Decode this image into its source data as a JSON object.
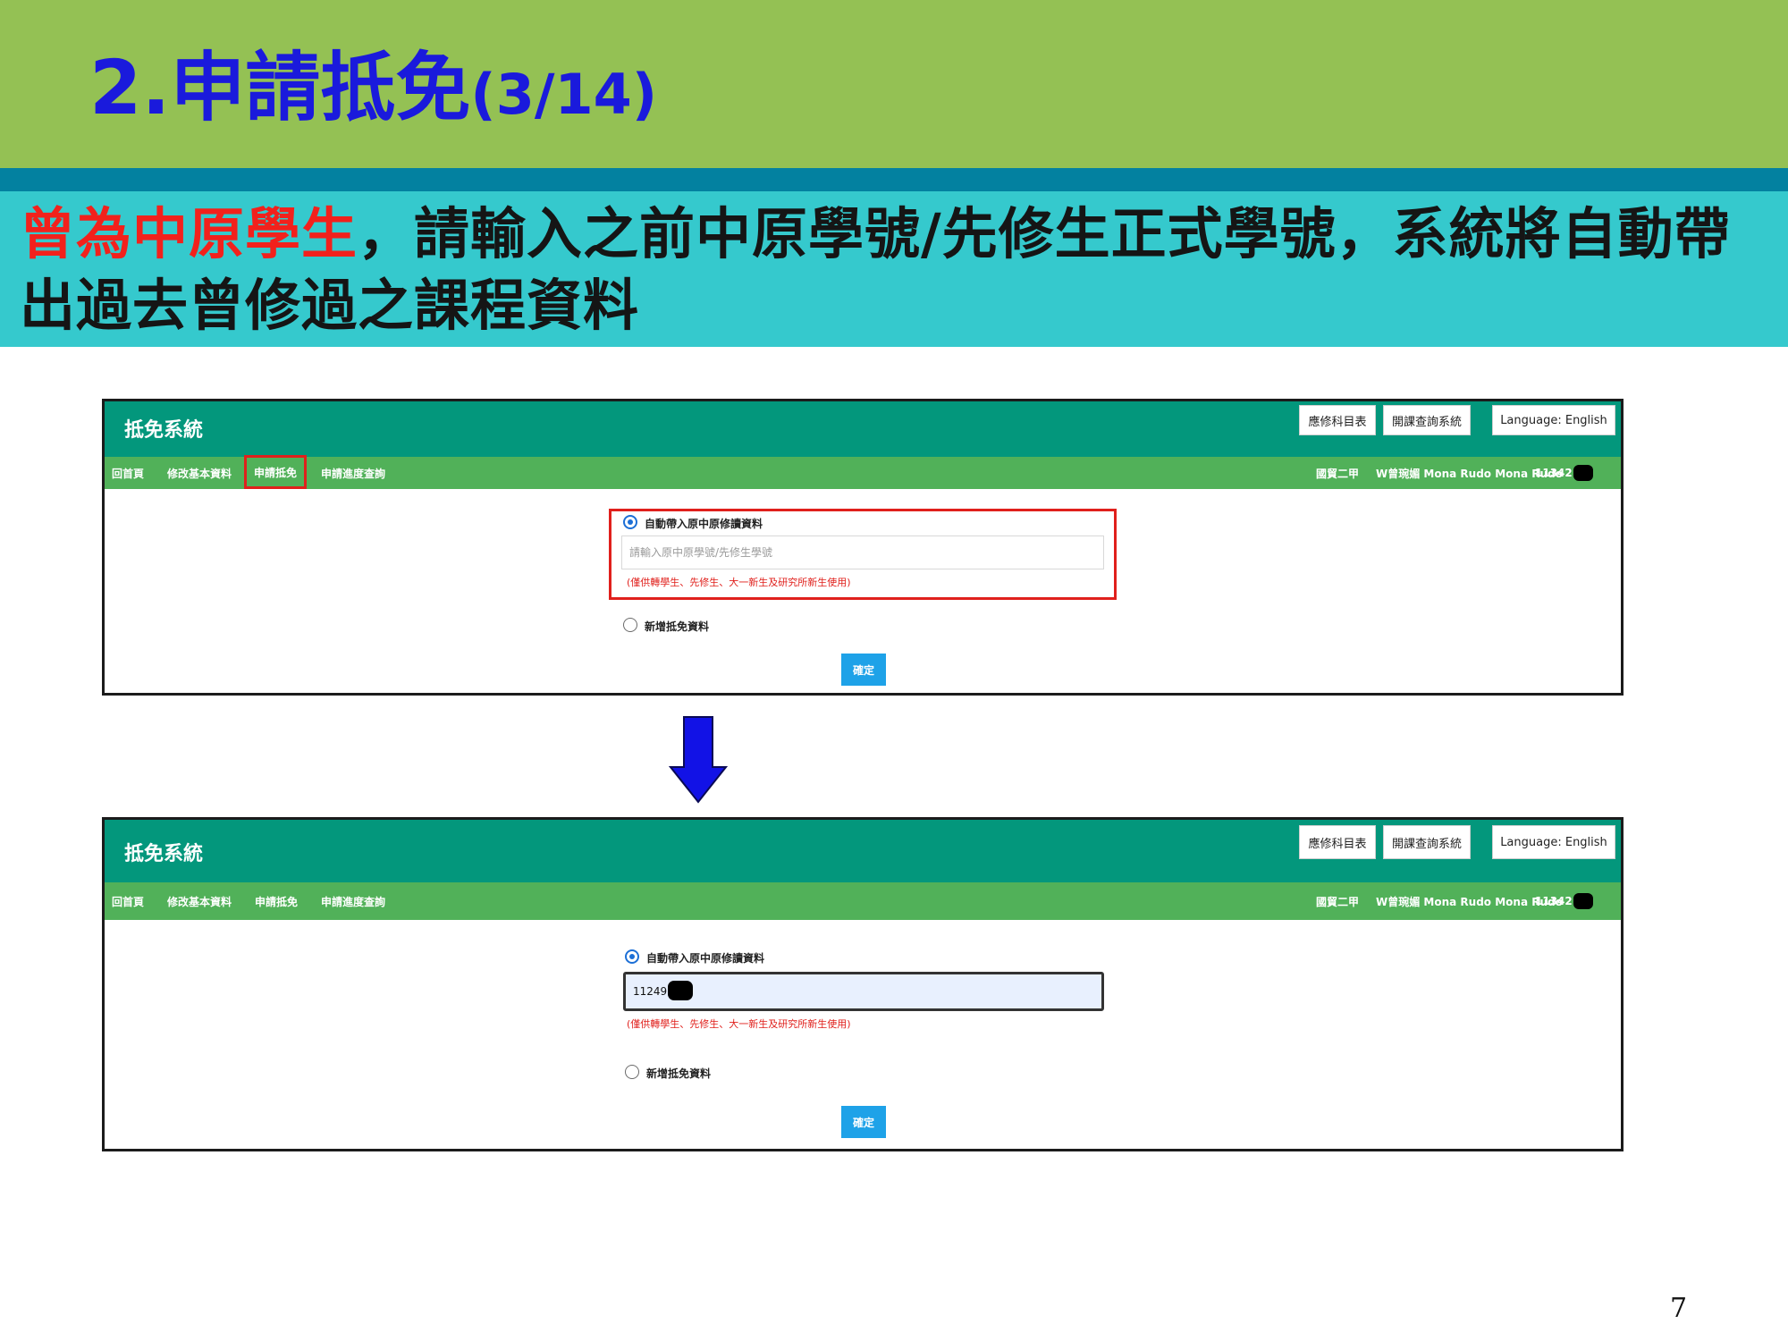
{
  "slide": {
    "title_main": "2.申請抵免",
    "title_sub": "(3/14)",
    "subtitle_highlight": "曾為中原學生",
    "subtitle_rest": "，請輸入之前中原學號/先修生正式學號，系統將自動帶出過去曾修過之課程資料",
    "page_number": "7"
  },
  "colors": {
    "title_band": "#94c154",
    "title_text": "#1a1adc",
    "subtitle_band": "#35c9cd",
    "highlight_text": "#f2211c",
    "app_header": "#03977c",
    "app_nav": "#51b159",
    "confirm_button": "#1ea2e8",
    "arrow": "#1212e6"
  },
  "screens": [
    {
      "app_title": "抵免系統",
      "header_buttons": [
        "應修科目表",
        "開課查詢系統",
        "Language: English"
      ],
      "nav_items": [
        "回首頁",
        "修改基本資料",
        "申請抵免",
        "申請進度查詢"
      ],
      "highlighted_nav": "申請抵免",
      "user_info": {
        "class": "國貿二甲",
        "name": "W曾琬媚 Mona Rudo Mona Rudo",
        "id_prefix": "11342"
      },
      "option_auto": "自動帶入原中原修讀資料",
      "input_placeholder": "請輸入原中原學號/先修生學號",
      "input_value": "",
      "note": "(僅供轉學生、先修生、大一新生及研究所新生使用)",
      "option_new": "新增抵免資料",
      "confirm": "確定"
    },
    {
      "app_title": "抵免系統",
      "header_buttons": [
        "應修科目表",
        "開課查詢系統",
        "Language: English"
      ],
      "nav_items": [
        "回首頁",
        "修改基本資料",
        "申請抵免",
        "申請進度查詢"
      ],
      "user_info": {
        "class": "國貿二甲",
        "name": "W曾琬媚 Mona Rudo Mona Rudo",
        "id_prefix": "11342"
      },
      "option_auto": "自動帶入原中原修讀資料",
      "input_value": "11249",
      "note": "(僅供轉學生、先修生、大一新生及研究所新生使用)",
      "option_new": "新增抵免資料",
      "confirm": "確定"
    }
  ]
}
